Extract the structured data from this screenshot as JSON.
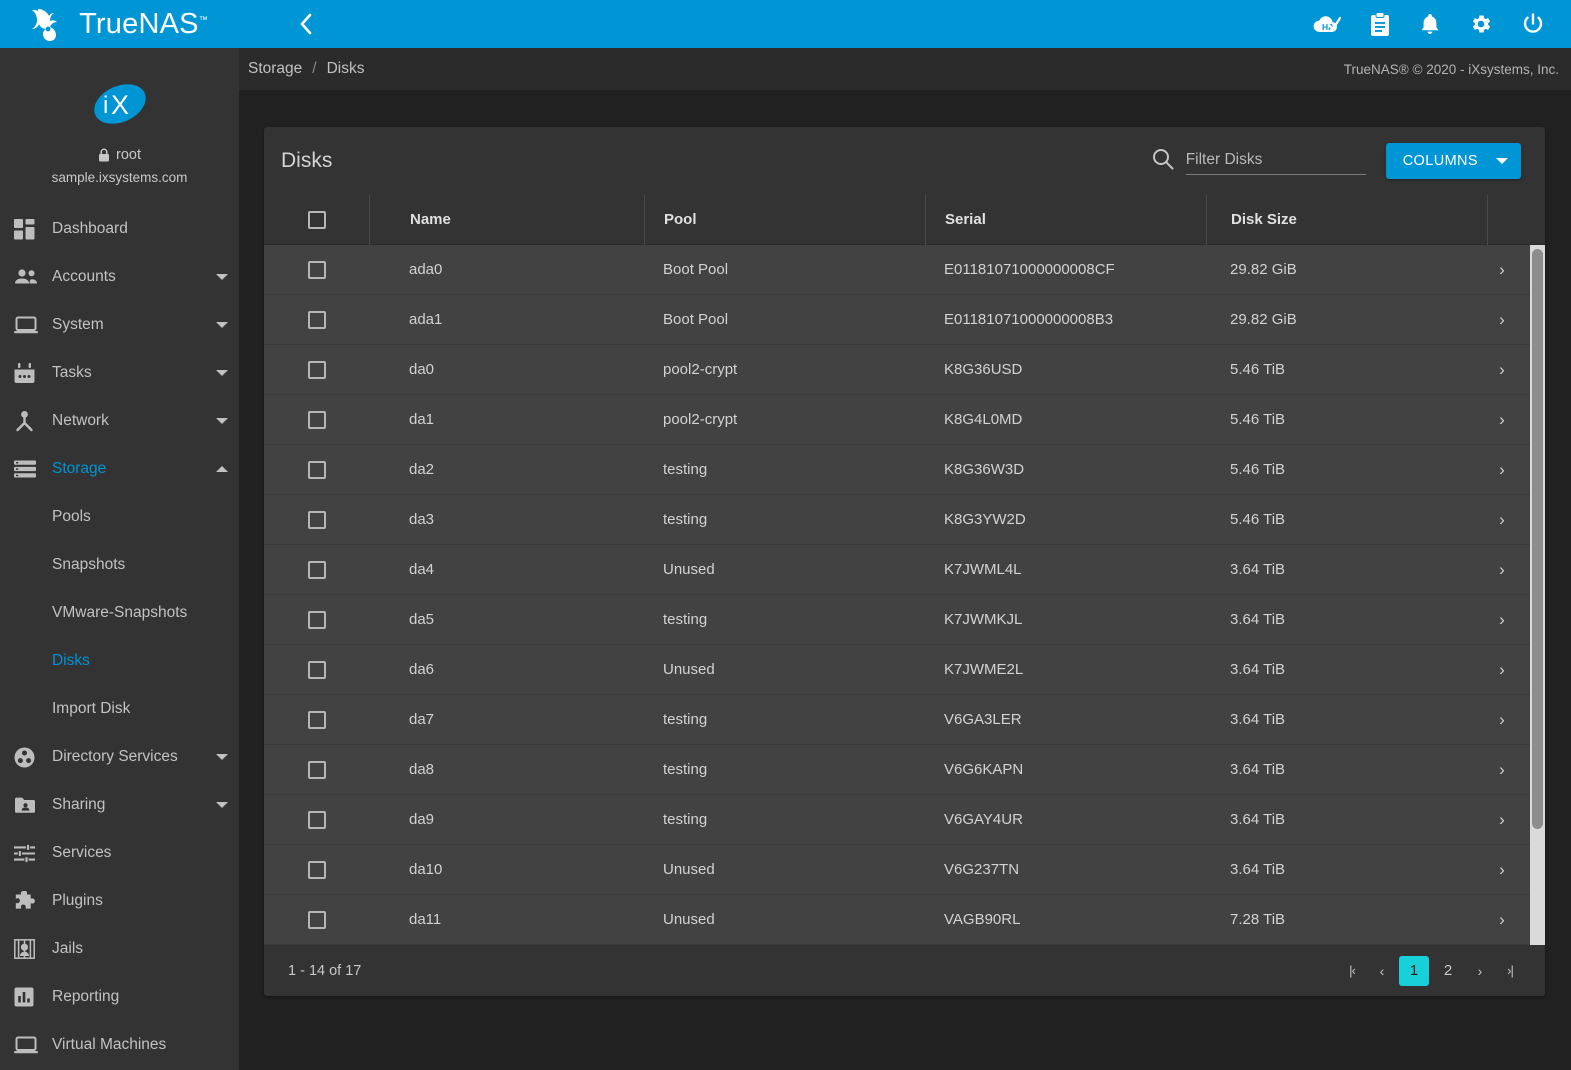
{
  "app": {
    "brand_name": "TrueNAS",
    "brand_tm": "™",
    "accent_color": "#0095d5",
    "page_background": "#212121"
  },
  "topbar": {
    "menu_icon": "hamburger-icon",
    "back_icon": "chevron-left-icon",
    "icons": [
      {
        "name": "ha-status-icon",
        "label": "HA"
      },
      {
        "name": "clipboard-icon",
        "label": ""
      },
      {
        "name": "bell-icon",
        "label": ""
      },
      {
        "name": "gear-icon",
        "label": ""
      },
      {
        "name": "power-icon",
        "label": ""
      }
    ]
  },
  "sidebar": {
    "logo": "ix-logo",
    "lock_icon": "lock-icon",
    "user": "root",
    "host": "sample.ixsystems.com",
    "items": [
      {
        "label": "Dashboard",
        "icon": "dashboard-icon",
        "expandable": false,
        "active": false,
        "sub": false
      },
      {
        "label": "Accounts",
        "icon": "accounts-icon",
        "expandable": true,
        "active": false,
        "sub": false
      },
      {
        "label": "System",
        "icon": "system-icon",
        "expandable": true,
        "active": false,
        "sub": false
      },
      {
        "label": "Tasks",
        "icon": "tasks-icon",
        "expandable": true,
        "active": false,
        "sub": false
      },
      {
        "label": "Network",
        "icon": "network-icon",
        "expandable": true,
        "active": false,
        "sub": false
      },
      {
        "label": "Storage",
        "icon": "storage-icon",
        "expandable": true,
        "active": true,
        "sub": false,
        "expanded": true
      },
      {
        "label": "Pools",
        "icon": "",
        "expandable": false,
        "active": false,
        "sub": true
      },
      {
        "label": "Snapshots",
        "icon": "",
        "expandable": false,
        "active": false,
        "sub": true
      },
      {
        "label": "VMware-Snapshots",
        "icon": "",
        "expandable": false,
        "active": false,
        "sub": true
      },
      {
        "label": "Disks",
        "icon": "",
        "expandable": false,
        "active": true,
        "sub": true
      },
      {
        "label": "Import Disk",
        "icon": "",
        "expandable": false,
        "active": false,
        "sub": true
      },
      {
        "label": "Directory Services",
        "icon": "directory-services-icon",
        "expandable": true,
        "active": false,
        "sub": false
      },
      {
        "label": "Sharing",
        "icon": "sharing-icon",
        "expandable": true,
        "active": false,
        "sub": false
      },
      {
        "label": "Services",
        "icon": "services-icon",
        "expandable": false,
        "active": false,
        "sub": false
      },
      {
        "label": "Plugins",
        "icon": "plugins-icon",
        "expandable": false,
        "active": false,
        "sub": false
      },
      {
        "label": "Jails",
        "icon": "jails-icon",
        "expandable": false,
        "active": false,
        "sub": false
      },
      {
        "label": "Reporting",
        "icon": "reporting-icon",
        "expandable": false,
        "active": false,
        "sub": false
      },
      {
        "label": "Virtual Machines",
        "icon": "virtual-machines-icon",
        "expandable": false,
        "active": false,
        "sub": false
      }
    ]
  },
  "breadcrumb": {
    "parent": "Storage",
    "separator": "/",
    "current": "Disks"
  },
  "copyright": "TrueNAS® © 2020 - iXsystems, Inc.",
  "card": {
    "title": "Disks",
    "search": {
      "value": "",
      "placeholder": "Filter Disks",
      "icon": "search-icon"
    },
    "columns_button": {
      "label": "COLUMNS",
      "icon": "chevron-down-icon"
    }
  },
  "table": {
    "select_all_checkbox": false,
    "headers": [
      "Name",
      "Pool",
      "Serial",
      "Disk Size"
    ],
    "row_arrow_icon": "chevron-right-icon",
    "rows": [
      {
        "name": "ada0",
        "pool": "Boot Pool",
        "serial": "E01181071000000008CF",
        "size": "29.82 GiB",
        "checked": false
      },
      {
        "name": "ada1",
        "pool": "Boot Pool",
        "serial": "E01181071000000008B3",
        "size": "29.82 GiB",
        "checked": false
      },
      {
        "name": "da0",
        "pool": "pool2-crypt",
        "serial": "K8G36USD",
        "size": "5.46 TiB",
        "checked": false
      },
      {
        "name": "da1",
        "pool": "pool2-crypt",
        "serial": "K8G4L0MD",
        "size": "5.46 TiB",
        "checked": false
      },
      {
        "name": "da2",
        "pool": "testing",
        "serial": "K8G36W3D",
        "size": "5.46 TiB",
        "checked": false
      },
      {
        "name": "da3",
        "pool": "testing",
        "serial": "K8G3YW2D",
        "size": "5.46 TiB",
        "checked": false
      },
      {
        "name": "da4",
        "pool": "Unused",
        "serial": "K7JWML4L",
        "size": "3.64 TiB",
        "checked": false
      },
      {
        "name": "da5",
        "pool": "testing",
        "serial": "K7JWMKJL",
        "size": "3.64 TiB",
        "checked": false
      },
      {
        "name": "da6",
        "pool": "Unused",
        "serial": "K7JWME2L",
        "size": "3.64 TiB",
        "checked": false
      },
      {
        "name": "da7",
        "pool": "testing",
        "serial": "V6GA3LER",
        "size": "3.64 TiB",
        "checked": false
      },
      {
        "name": "da8",
        "pool": "testing",
        "serial": "V6G6KAPN",
        "size": "3.64 TiB",
        "checked": false
      },
      {
        "name": "da9",
        "pool": "testing",
        "serial": "V6GAY4UR",
        "size": "3.64 TiB",
        "checked": false
      },
      {
        "name": "da10",
        "pool": "Unused",
        "serial": "V6G237TN",
        "size": "3.64 TiB",
        "checked": false
      },
      {
        "name": "da11",
        "pool": "Unused",
        "serial": "VAGB90RL",
        "size": "7.28 TiB",
        "checked": false
      }
    ]
  },
  "footer": {
    "range_text": "1 - 14 of 17",
    "first_icon": "first-page-icon",
    "prev_icon": "prev-page-icon",
    "next_icon": "next-page-icon",
    "last_icon": "last-page-icon",
    "pages": [
      "1",
      "2"
    ],
    "current_page": "1",
    "current_page_color": "#18d0d8"
  }
}
